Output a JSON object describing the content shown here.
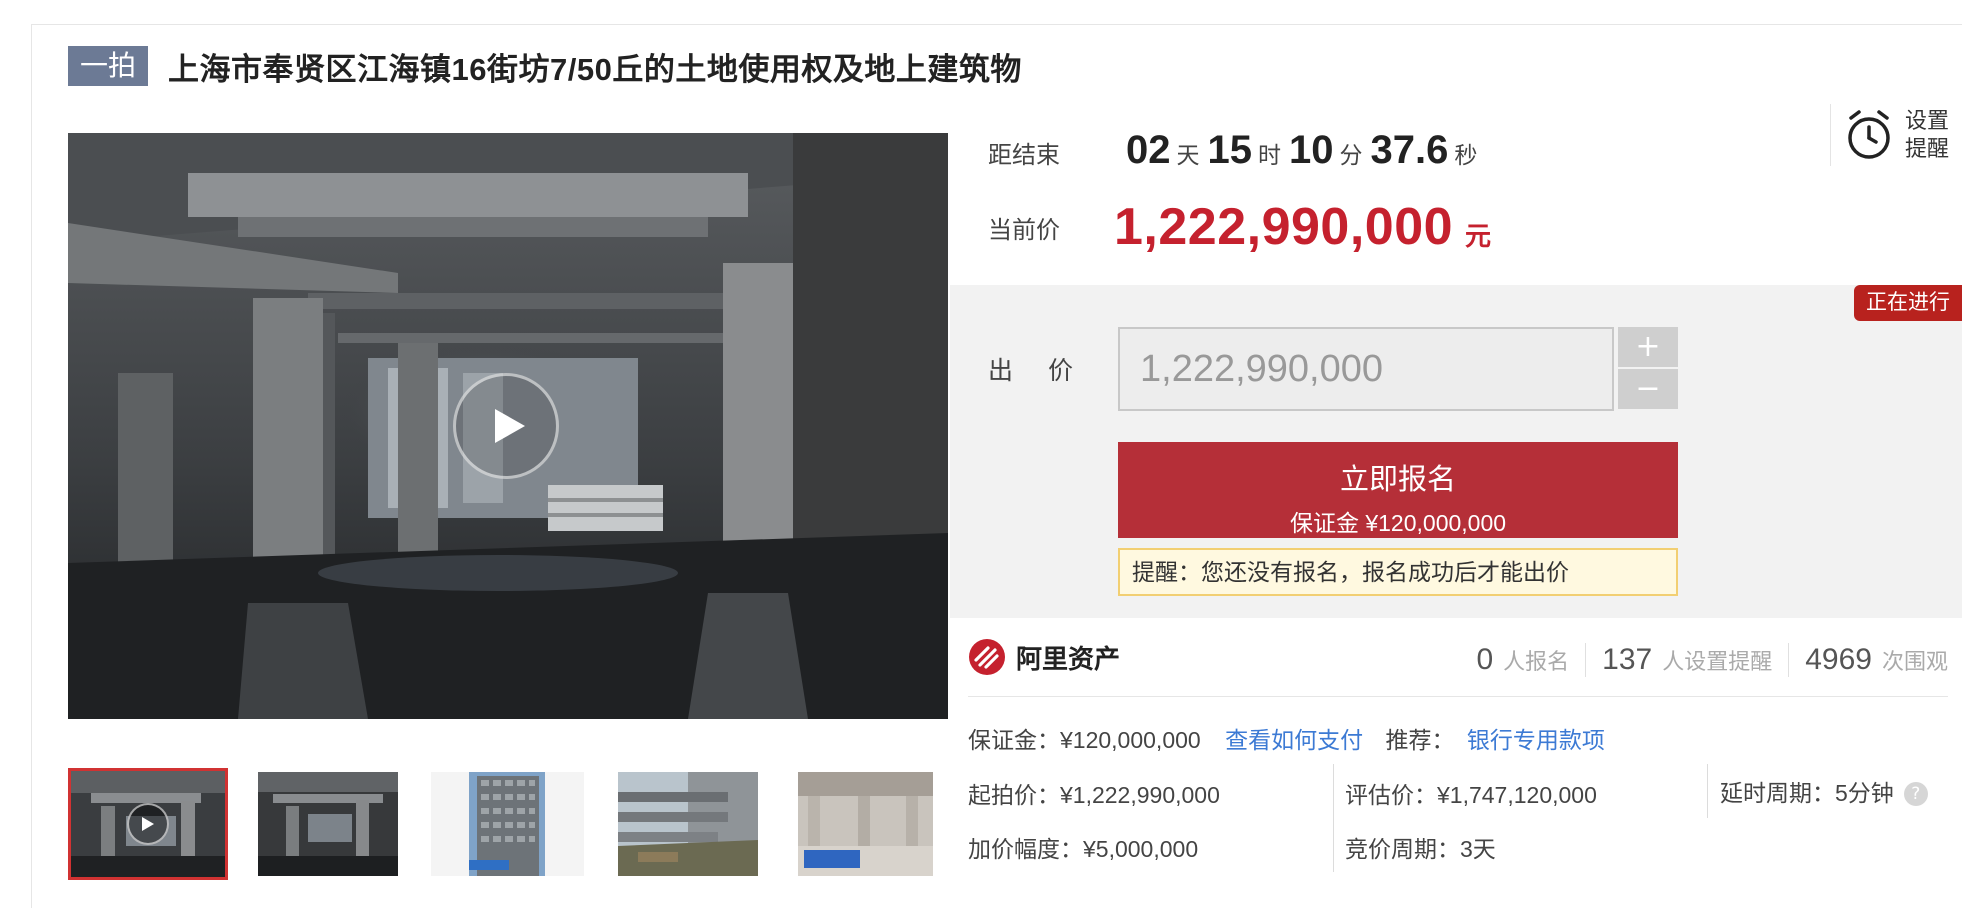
{
  "header": {
    "tag": "一拍",
    "title": "上海市奉贤区江海镇16街坊7/50丘的土地使用权及地上建筑物"
  },
  "countdown": {
    "label": "距结束",
    "days": "02",
    "days_unit": "天",
    "hours": "15",
    "hours_unit": "时",
    "minutes": "10",
    "minutes_unit": "分",
    "seconds": "37.6",
    "seconds_unit": "秒"
  },
  "reminder": {
    "line1": "设置",
    "line2": "提醒"
  },
  "current_price": {
    "label": "当前价",
    "value": "1,222,990,000",
    "unit": "元"
  },
  "bid": {
    "status": "正在进行",
    "label": "出 价",
    "input_value": "1,222,990,000",
    "plus": "+",
    "minus": "−",
    "signup_label": "立即报名",
    "deposit_line": "保证金 ¥120,000,000",
    "notice": "提醒：您还没有报名，报名成功后才能出价"
  },
  "platform": {
    "name": "阿里资产"
  },
  "stats": [
    {
      "num": "0",
      "label": "人报名"
    },
    {
      "num": "137",
      "label": "人设置提醒"
    },
    {
      "num": "4969",
      "label": "次围观"
    }
  ],
  "details": {
    "deposit": "保证金：¥120,000,000",
    "how_to_pay": "查看如何支付",
    "recommend_label": "推荐：",
    "recommend_link": "银行专用款项",
    "start_price": "起拍价：¥1,222,990,000",
    "appraisal": "评估价：¥1,747,120,000",
    "delay_period": "延时周期：5分钟",
    "increment": "加价幅度：¥5,000,000",
    "bid_period": "竞价周期：3天"
  },
  "icons": {
    "play": "play-icon",
    "alarm": "alarm-clock-icon",
    "help": "help-icon",
    "logo": "ali-asset-logo-icon"
  },
  "colors": {
    "accent_red": "#c5212e",
    "button_red": "#b52f38",
    "badge_red": "#b8221e",
    "tag_slate": "#6c7a95",
    "link_blue": "#3c7ad4",
    "notice_bg": "#fff9e0"
  }
}
